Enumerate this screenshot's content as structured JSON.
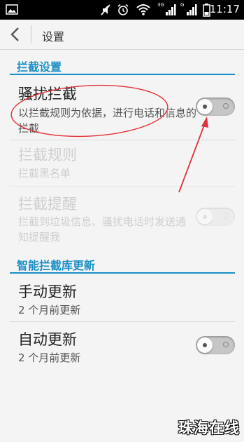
{
  "status_bar": {
    "time": "11:17",
    "network_1": "3G",
    "network_2": "G",
    "icons": [
      "gallery-icon",
      "mute-icon",
      "alarm-icon",
      "wifi-icon",
      "signal-icon",
      "battery-icon"
    ]
  },
  "header": {
    "title": "设置",
    "back_icon": "chevron-left-icon"
  },
  "sections": [
    {
      "title": "拦截设置"
    },
    {
      "title": "智能拦截库更新"
    }
  ],
  "items": {
    "harass": {
      "title": "骚扰拦截",
      "subtitle": "以拦截规则为依据，进行电话和信息的拦截",
      "toggle": "off",
      "enabled": true
    },
    "rules": {
      "title": "拦截规则",
      "subtitle": "拦截黑名单",
      "enabled": false
    },
    "notify": {
      "title": "拦截提醒",
      "subtitle": "拦截到垃圾信息、骚扰电话时发送通知提醒我",
      "toggle": "off",
      "enabled": false
    },
    "manual": {
      "title": "手动更新",
      "subtitle": "2 个月前更新"
    },
    "auto": {
      "title": "自动更新",
      "subtitle": "2 个月前更新",
      "toggle": "off"
    }
  },
  "colors": {
    "accent": "#1a8fc5",
    "annotation": "#e0323a"
  },
  "watermark": "珠海在线"
}
